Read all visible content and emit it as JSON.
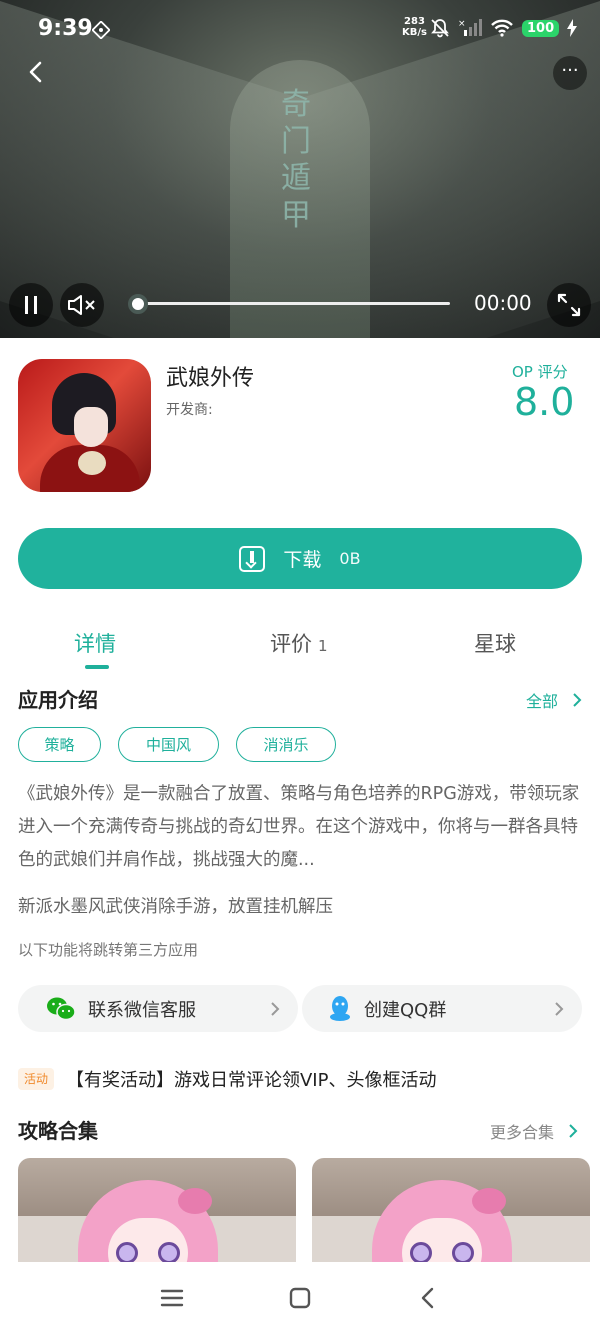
{
  "status_bar": {
    "time": "9:39",
    "net_speed_value": "283",
    "net_speed_unit": "KB/s",
    "battery": "100"
  },
  "video": {
    "art_title": "奇门遁甲",
    "current_time": "00:00",
    "progress_fraction": 0.0
  },
  "app": {
    "name": "武娘外传",
    "developer_label": "开发商:",
    "score_label": "OP 评分",
    "score_value": "8.0"
  },
  "download": {
    "label": "下载",
    "size": "0B"
  },
  "tabs": [
    {
      "label": "详情",
      "count": ""
    },
    {
      "label": "评价",
      "count": "1"
    },
    {
      "label": "星球",
      "count": ""
    }
  ],
  "intro": {
    "title": "应用介绍",
    "more_label": "全部",
    "tags": [
      "策略",
      "中国风",
      "消消乐"
    ],
    "description": "《武娘外传》是一款融合了放置、策略与角色培养的RPG游戏，带领玩家进入一个充满传奇与挑战的奇幻世界。在这个游戏中，你将与一群各具特色的武娘们并肩作战，挑战强大的魔...",
    "slogan": "新派水墨风武侠消除手游，放置挂机解压",
    "third_party_note": "以下功能将跳转第三方应用"
  },
  "contacts": [
    {
      "label": "联系微信客服",
      "icon": "wechat-icon"
    },
    {
      "label": "创建QQ群",
      "icon": "qq-icon"
    }
  ],
  "activity": {
    "badge": "活动",
    "text": "【有奖活动】游戏日常评论领VIP、头像框活动"
  },
  "guides": {
    "title": "攻略合集",
    "more_label": "更多合集"
  },
  "colors": {
    "accent": "#1fb09b",
    "button": "#20b29d",
    "activity_badge_bg": "#fdf1e4",
    "activity_badge_text": "#f08a2c"
  }
}
